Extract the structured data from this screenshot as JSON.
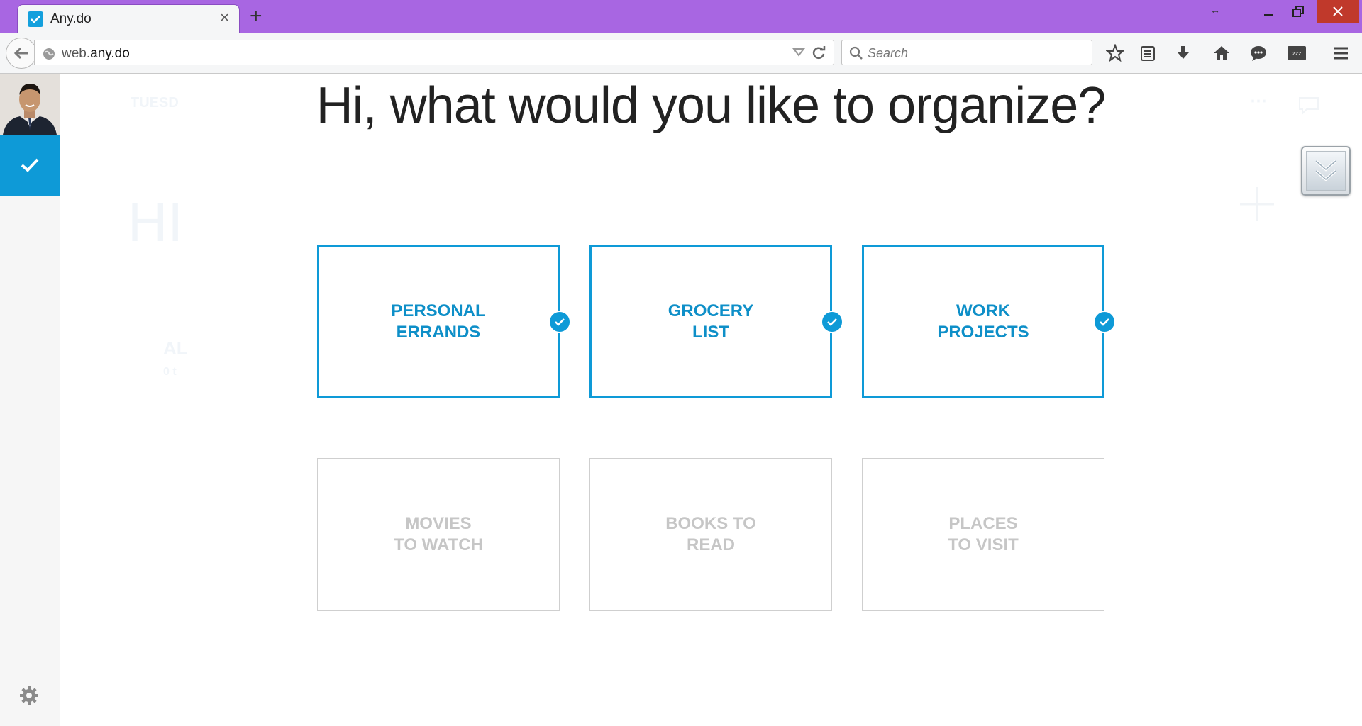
{
  "browser": {
    "tab_title": "Any.do",
    "tab_close": "×",
    "new_tab": "+",
    "resize_indicator": "↔",
    "url_prefix": "web.",
    "url_domain": "any.do",
    "search_placeholder": "Search",
    "toolbar_icons": [
      "bookmark-star-icon",
      "reading-list-icon",
      "download-icon",
      "home-icon",
      "chat-icon",
      "sleep-icon",
      "menu-icon"
    ],
    "window_controls": [
      "minimize",
      "restore",
      "close"
    ]
  },
  "background_ghost": {
    "day": "TUESD",
    "greeting": "HI",
    "item": "AL",
    "sub": "0 t"
  },
  "main": {
    "heading": "Hi, what would you like to organize?",
    "selected_cards": [
      {
        "line1": "PERSONAL",
        "line2": "ERRANDS",
        "checked": true
      },
      {
        "line1": "GROCERY",
        "line2": "LIST",
        "checked": true
      },
      {
        "line1": "WORK",
        "line2": "PROJECTS",
        "checked": true
      }
    ],
    "unselected_cards": [
      {
        "line1": "MOVIES",
        "line2": "TO WATCH",
        "checked": false
      },
      {
        "line1": "BOOKS TO",
        "line2": "READ",
        "checked": false
      },
      {
        "line1": "PLACES",
        "line2": "TO VISIT",
        "checked": false
      }
    ]
  },
  "colors": {
    "accent": "#0e9ad7",
    "titlebar": "#a866e2",
    "unselected_text": "#c6c6c6"
  }
}
